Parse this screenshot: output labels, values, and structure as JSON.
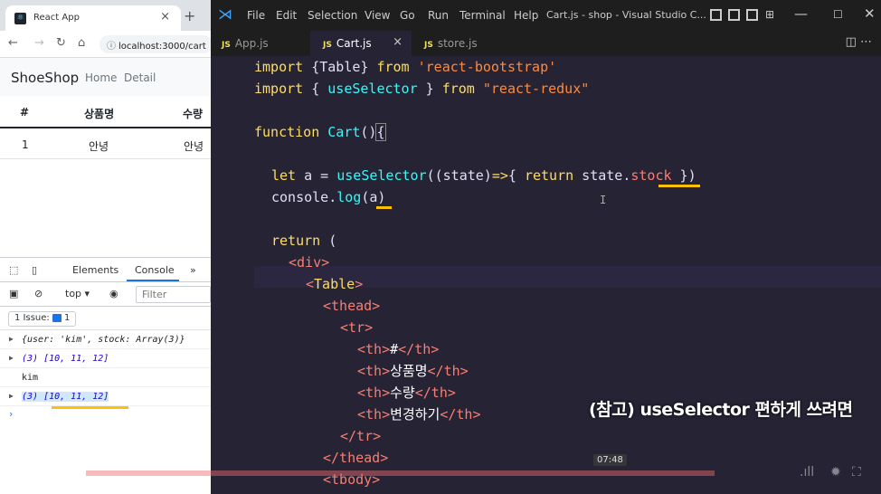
{
  "browser": {
    "tab_title": "React App",
    "url": "localhost:3000/cart",
    "app": {
      "brand": "ShoeShop",
      "nav_links": [
        "Home",
        "Detail"
      ]
    },
    "table": {
      "headers": [
        "#",
        "상품명",
        "수량"
      ],
      "rows": [
        [
          "1",
          "안녕",
          "안녕"
        ]
      ]
    },
    "devtools": {
      "tabs": [
        "Elements",
        "Console"
      ],
      "more": "»",
      "context": "top ▾",
      "filter_placeholder": "Filter",
      "issues_label": "1 Issue:",
      "issues_count": "1",
      "logs": [
        "{user: 'kim', stock: Array(3)}",
        "(3) [10, 11, 12]",
        "kim",
        "(3) [10, 11, 12]"
      ]
    }
  },
  "vscode": {
    "menu": [
      "File",
      "Edit",
      "Selection",
      "View",
      "Go",
      "Run",
      "Terminal",
      "Help"
    ],
    "window_title": "Cart.js - shop - Visual Studio C...",
    "tabs": [
      {
        "label": "App.js",
        "active": false
      },
      {
        "label": "Cart.js",
        "active": true
      },
      {
        "label": "store.js",
        "active": false
      }
    ],
    "caption": "(참고) useSelector 편하게 쓰려면"
  },
  "video": {
    "timestamp": "07:48"
  },
  "colors": {
    "editor_bg": "#262335",
    "keyword": "#fede5d",
    "function": "#36f9f6",
    "string": "#ff8b39",
    "tag": "#f97e72",
    "highlight_underline": "#ffc107"
  }
}
